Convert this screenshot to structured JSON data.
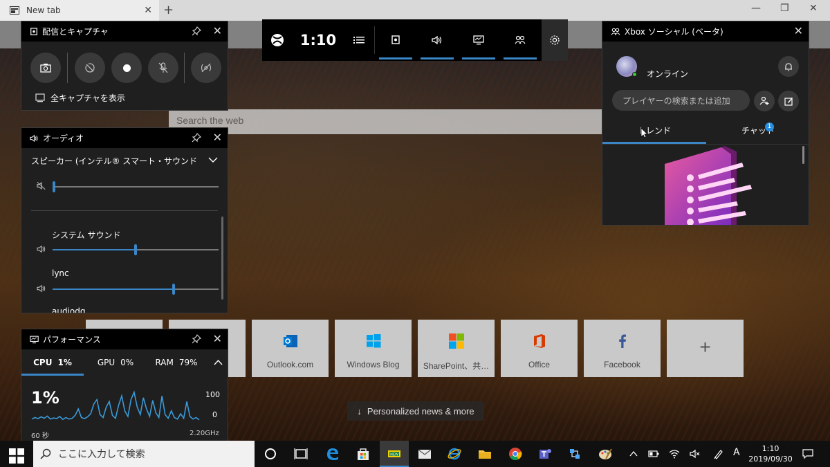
{
  "browser": {
    "tab_title": "New tab",
    "search_placeholder": "Search the web",
    "news_label": "Personalized news & more"
  },
  "quick_links": [
    {
      "label": "Outlook.com",
      "icon": "outlook-icon",
      "color": "#0078d4"
    },
    {
      "label": "Windows Blog",
      "icon": "windows-icon",
      "color": "#00a2ed"
    },
    {
      "label": "SharePoint、共…",
      "icon": "microsoft-icon",
      "color": "#f25022"
    },
    {
      "label": "Office",
      "icon": "office-icon",
      "color": "#d83b01"
    },
    {
      "label": "Facebook",
      "icon": "facebook-icon",
      "color": "#3b5998"
    }
  ],
  "gamebar": {
    "time": "1:10",
    "capture": {
      "title": "配信とキャプチャ",
      "show_all": "全キャプチャを表示"
    },
    "audio": {
      "title": "オーディオ",
      "device": "スピーカー (インテル® スマート・サウンド・テクノロ…",
      "master_level": 0.01,
      "apps": [
        {
          "name": "システム サウンド",
          "level": 0.5
        },
        {
          "name": "lync",
          "level": 0.73
        },
        {
          "name": "audiodg"
        }
      ]
    },
    "performance": {
      "title": "パフォーマンス",
      "tabs": [
        {
          "name": "CPU",
          "value": "1%"
        },
        {
          "name": "GPU",
          "value": "0%"
        },
        {
          "name": "RAM",
          "value": "79%"
        }
      ],
      "current": "1%",
      "ymax": "100",
      "ymin": "0",
      "duration": "60 秒",
      "freq": "2.20GHz",
      "samples": [
        8,
        12,
        9,
        14,
        10,
        16,
        8,
        11,
        9,
        15,
        7,
        12,
        8,
        10,
        18,
        35,
        12,
        9,
        14,
        22,
        48,
        60,
        20,
        12,
        40,
        55,
        18,
        10,
        45,
        70,
        30,
        15,
        60,
        80,
        40,
        20,
        65,
        35,
        15,
        58,
        25,
        12,
        70,
        20,
        10,
        30,
        12,
        8,
        22,
        10,
        55,
        15,
        8,
        12,
        6
      ]
    },
    "social": {
      "title": "Xbox ソーシャル (ベータ)",
      "status": "オンライン",
      "search_placeholder": "プレイヤーの検索または追加",
      "tabs": {
        "trend": "トレンド",
        "chat": "チャット",
        "chat_badge": "1"
      }
    }
  },
  "taskbar": {
    "search_placeholder": "ここに入力して検索",
    "time": "1:10",
    "date": "2019/09/30"
  }
}
